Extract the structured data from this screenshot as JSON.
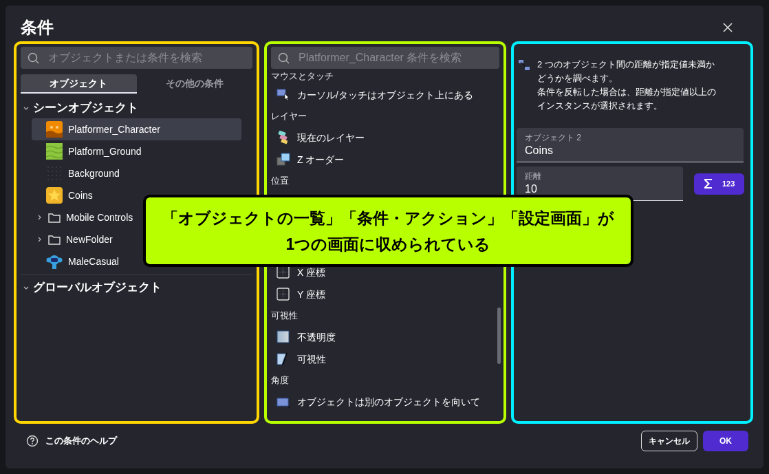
{
  "dialog": {
    "title": "条件"
  },
  "objects_panel": {
    "search_placeholder": "オブジェクトまたは条件を検索",
    "tabs": [
      {
        "label": "オブジェクト",
        "selected": true
      },
      {
        "label": "その他の条件",
        "selected": false
      }
    ],
    "tree": [
      {
        "label": "シーンオブジェクト",
        "kind": "group",
        "expanded": true,
        "children": [
          {
            "label": "Platformer_Character",
            "kind": "object",
            "selected": true
          },
          {
            "label": "Platform_Ground",
            "kind": "object",
            "selected": false
          },
          {
            "label": "Background",
            "kind": "object",
            "selected": false
          },
          {
            "label": "Coins",
            "kind": "object",
            "selected": false
          },
          {
            "label": "Mobile Controls",
            "kind": "folder",
            "expanded": false,
            "selected": false
          },
          {
            "label": "NewFolder",
            "kind": "folder",
            "expanded": false,
            "selected": false
          },
          {
            "label": "MaleCasual",
            "kind": "object",
            "selected": false
          }
        ]
      },
      {
        "label": "グローバルオブジェクト",
        "kind": "group",
        "expanded": true
      }
    ]
  },
  "conditions_panel": {
    "search_placeholder": "Platformer_Character 条件を検索",
    "sections": [
      {
        "title": "マウスとタッチ",
        "items": [
          {
            "label": "カーソル/タッチはオブジェクト上にある"
          }
        ]
      },
      {
        "title": "レイヤー",
        "items": [
          {
            "label": "現在のレイヤー"
          },
          {
            "label": "Z オーダー"
          }
        ]
      },
      {
        "title": "位置",
        "items": [
          {
            "label": "X 座標"
          },
          {
            "label": "Y 座標"
          }
        ]
      },
      {
        "title": "可視性",
        "items": [
          {
            "label": "不透明度"
          },
          {
            "label": "可視性"
          }
        ]
      },
      {
        "title": "角度",
        "items": [
          {
            "label": "オブジェクトは別のオブジェクトを向いて"
          }
        ]
      }
    ]
  },
  "settings_panel": {
    "description": [
      "2 つのオブジェクト間の距離が指定値未満かどうかを調べます。",
      "条件を反転した場合は、距離が指定値以上のインスタンスが選択されます。"
    ],
    "fields": [
      {
        "label": "オブジェクト 2",
        "value": "Coins"
      },
      {
        "label": "距離",
        "value": "10",
        "button": "123"
      }
    ]
  },
  "footer": {
    "help": "この条件のヘルプ",
    "buttons": [
      {
        "label": "キャンセル",
        "kind": "secondary"
      },
      {
        "label": "OK",
        "kind": "primary"
      }
    ]
  },
  "callout": {
    "lines": [
      "「オブジェクトの一覧」「条件・アクション」「設定画面」が",
      "1つの画面に収められている"
    ]
  }
}
